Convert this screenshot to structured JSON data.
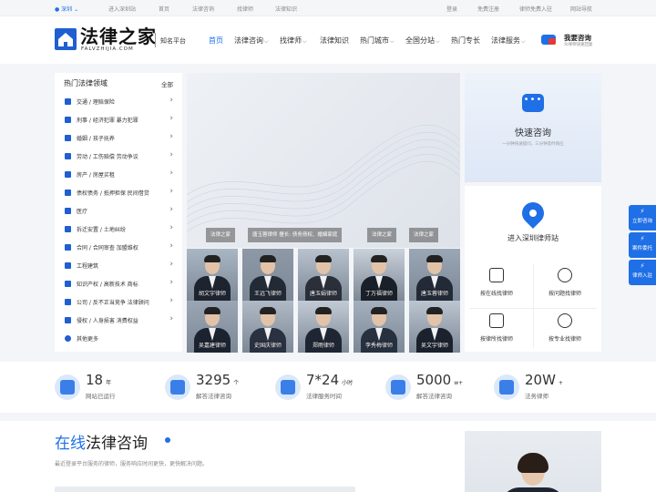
{
  "topbar": {
    "city": "深圳",
    "enter_city": "进入深圳站",
    "home": "首页",
    "consult": "法律咨询",
    "find_lawyer": "找律师",
    "knowledge": "法律知识",
    "login": "登录",
    "register": "免费注册",
    "lawyer_join": "律师免费入驻",
    "site_nav": "网站导航"
  },
  "header": {
    "logo_title": "法律之家",
    "logo_sub": "FALVZHIJIA.COM",
    "logo_tag": "知名平台",
    "nav": [
      {
        "label": "首页",
        "active": true,
        "chevron": false
      },
      {
        "label": "法律咨询",
        "chevron": true
      },
      {
        "label": "找律师",
        "chevron": true
      },
      {
        "label": "法律知识",
        "chevron": false
      },
      {
        "label": "热门城市",
        "chevron": true
      },
      {
        "label": "全国分站",
        "chevron": true
      },
      {
        "label": "热门专长",
        "chevron": false
      },
      {
        "label": "法律服务",
        "chevron": true
      }
    ],
    "consult_title": "我要咨询",
    "consult_sub": "众律师快速回复"
  },
  "categories": {
    "title": "热门法律领域",
    "all": "全部",
    "items": [
      {
        "label": "交通 / 理赔保险",
        "icon": "car-icon"
      },
      {
        "label": "刑事 / 经济犯罪  暴力犯罪",
        "icon": "shield-icon"
      },
      {
        "label": "婚姻 / 孩子抚养",
        "icon": "family-icon"
      },
      {
        "label": "劳动 / 工伤赔偿  劳动争议",
        "icon": "worker-icon"
      },
      {
        "label": "房产 / 房屋买租",
        "icon": "house-icon"
      },
      {
        "label": "债权债务 / 抵押担保  民间借贷",
        "icon": "debt-icon"
      },
      {
        "label": "医疗",
        "icon": "medical-icon"
      },
      {
        "label": "拆迁安置 / 土地纠纷",
        "icon": "demolition-icon"
      },
      {
        "label": "合同 / 合同审查  加盟维权",
        "icon": "contract-icon"
      },
      {
        "label": "工程建筑",
        "icon": "construction-icon"
      },
      {
        "label": "知识产权 / 高新技术  商标",
        "icon": "ip-icon"
      },
      {
        "label": "公司 / 反不正当竞争  法律顾问",
        "icon": "company-icon"
      },
      {
        "label": "侵权 / 人身损害  消费权益",
        "icon": "gavel-icon"
      },
      {
        "label": "其他更多",
        "icon": "more-icon"
      }
    ]
  },
  "banner": {
    "tags": [
      "法律之家",
      "唐玉蓉律师 擅长: 债务债权、婚姻家庭",
      "法律之家",
      "法律之家"
    ]
  },
  "lawyers": [
    {
      "name": "胡文宇律师"
    },
    {
      "name": "王远飞律师"
    },
    {
      "name": "唐玉娟律师"
    },
    {
      "name": "丁万福律师"
    },
    {
      "name": "唐玉蓉律师"
    },
    {
      "name": "吴嘉建律师"
    },
    {
      "name": "史国庆律师"
    },
    {
      "name": "郑雨律师"
    },
    {
      "name": "李秀梅律师"
    },
    {
      "name": "吴文宇律师"
    }
  ],
  "quick_consult": {
    "title": "快速咨询",
    "sub": "一分钟快速提问，三分钟及时响应"
  },
  "services": {
    "enter_site": "进入深圳律师站",
    "items": [
      {
        "label": "按在线找律师",
        "icon": "document-icon"
      },
      {
        "label": "按问题找律师",
        "icon": "lightbulb-icon"
      },
      {
        "label": "按律所找律师",
        "icon": "building-icon"
      },
      {
        "label": "按专业找律师",
        "icon": "badge-icon"
      }
    ]
  },
  "side_tabs": [
    {
      "label": "立即咨询",
      "icon": "chat-icon"
    },
    {
      "label": "案件委托",
      "icon": "case-icon"
    },
    {
      "label": "律师入驻",
      "icon": "user-icon"
    }
  ],
  "stats": [
    {
      "value": "18",
      "unit": "年",
      "label": "网站已运行",
      "icon": "mail-icon"
    },
    {
      "value": "3295",
      "unit": "个",
      "label": "解答法律咨询",
      "icon": "clock-icon"
    },
    {
      "value": "7*24",
      "unit": "小时",
      "label": "法律服务时间",
      "icon": "building-icon"
    },
    {
      "value": "5000",
      "unit": "w+",
      "label": "解答法律咨询",
      "icon": "compass-icon"
    },
    {
      "value": "20W",
      "unit": "+",
      "label": "法务律师",
      "icon": "database-icon"
    }
  ],
  "consult_section": {
    "title_blue": "在线",
    "title_rest": "法律咨询",
    "sub": "最近登录平台服务的律师，服务响应时间更快，更快解决问题。"
  },
  "colors": {
    "accent": "#1f6fe6",
    "brand": "#1f5fd0"
  }
}
